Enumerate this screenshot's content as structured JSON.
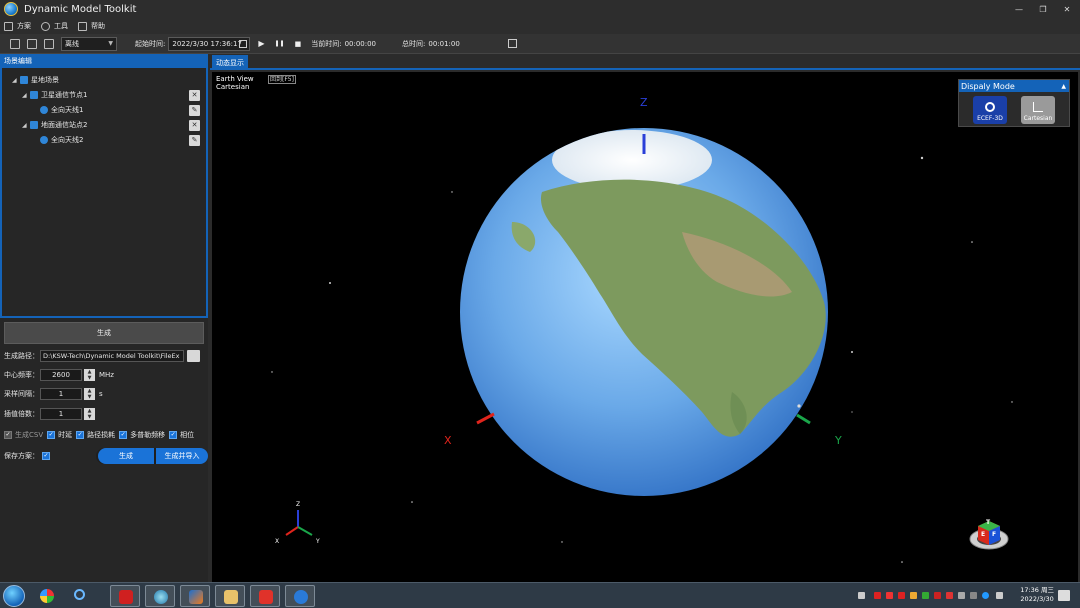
{
  "window": {
    "title": "Dynamic Model Toolkit",
    "controls": [
      "—",
      "❐",
      "✕"
    ]
  },
  "menu": {
    "items": [
      {
        "label": "方案",
        "icon": "file-icon"
      },
      {
        "label": "工具",
        "icon": "gear-icon"
      },
      {
        "label": "帮助",
        "icon": "help-icon"
      }
    ]
  },
  "toolbar": {
    "mode_select": "离线",
    "start_time_label": "起始时间:",
    "start_time_value": "2022/3/30 17:36:17",
    "current_time_label": "当前时间:",
    "current_time_value": "00:00:00",
    "total_time_label": "总时间:",
    "total_time_value": "00:01:00",
    "play": "▶",
    "pause": "❚❚",
    "stop": "■"
  },
  "left_panel": {
    "header": "场景编辑",
    "tree": [
      {
        "label": "星地场景",
        "level": 0,
        "icon": "scene-icon",
        "toggle": "◢"
      },
      {
        "label": "卫星通信节点1",
        "level": 1,
        "icon": "satellite-icon",
        "toggle": "◢",
        "action": "remove-icon"
      },
      {
        "label": "全向天线1",
        "level": 2,
        "icon": "antenna-icon",
        "action": "edit-icon"
      },
      {
        "label": "地面通信站点2",
        "level": 1,
        "icon": "ground-station-icon",
        "toggle": "◢",
        "action": "remove-icon"
      },
      {
        "label": "全向天线2",
        "level": 2,
        "icon": "antenna-icon",
        "action": "edit-icon"
      }
    ],
    "generate_button": "生成",
    "form": {
      "path_label": "生成路径：",
      "path_value": "D:\\KSW-Tech\\Dynamic Model Toolkit\\FileEx",
      "center_freq_label": "中心频率：",
      "center_freq_value": "2600",
      "center_freq_unit": "MHz",
      "sample_interval_label": "采样间隔：",
      "sample_interval_value": "1",
      "sample_interval_unit": "s",
      "interp_label": "插值倍数：",
      "interp_value": "1"
    },
    "checks": [
      {
        "label": "生成CSV",
        "checked": true,
        "disabled": true
      },
      {
        "label": "时延",
        "checked": true
      },
      {
        "label": "路径损耗",
        "checked": true
      },
      {
        "label": "多普勒频移",
        "checked": true
      },
      {
        "label": "相位",
        "checked": true
      }
    ],
    "save_label": "保存方案：",
    "save_checked": true,
    "gen_pill": "生成",
    "gen_import_pill": "生成并导入"
  },
  "view": {
    "tab": "动态显示",
    "info_line1": "Earth View",
    "info_line2": "Cartesian",
    "info_tag": "回到[F5]",
    "display_mode": {
      "title": "Dispaly Mode",
      "buttons": [
        {
          "label": "ECEF-3D",
          "active": true
        },
        {
          "label": "Cartesian",
          "active": false
        }
      ]
    },
    "axes": {
      "z": "Z",
      "x": "X",
      "y": "Y"
    },
    "mini_axes": {
      "z": "Z",
      "x": "X",
      "y": "Y"
    },
    "nav_cube": {
      "top": "T",
      "left": "E",
      "right": "F"
    }
  },
  "taskbar": {
    "time": "17:36 周三",
    "date": "2022/3/30",
    "apps": [
      "explorer-icon",
      "search-icon",
      "app-red-icon",
      "browser-icon",
      "matlab-icon",
      "files-icon",
      "wps-icon",
      "s-icon"
    ]
  },
  "colors": {
    "accent": "#1463b8",
    "panel": "#262626",
    "x_axis": "#e0241c",
    "y_axis": "#1aa64a",
    "z_axis": "#2a3fd8"
  }
}
